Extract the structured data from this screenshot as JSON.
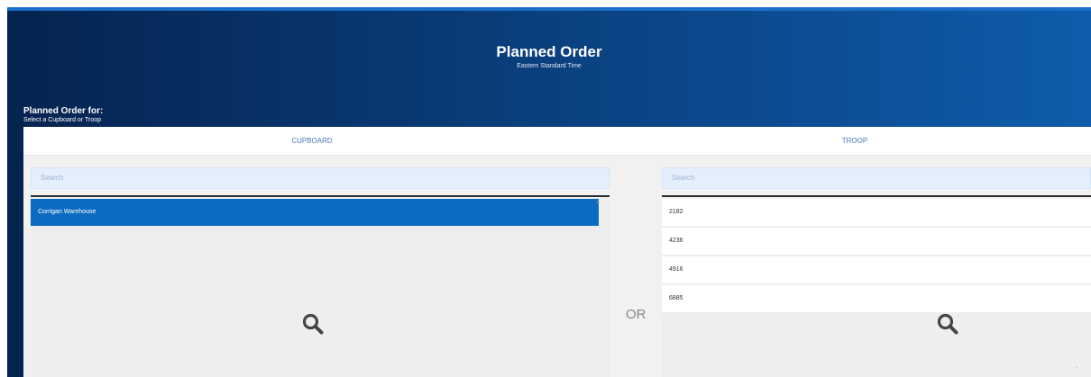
{
  "header": {
    "title": "Planned Order",
    "subtitle": "Eastern Standard Time"
  },
  "planned_for": {
    "title": "Planned Order for:",
    "subtitle": "Select a Cupboard or Troop"
  },
  "tabs": [
    {
      "label": "CUPBOARD"
    },
    {
      "label": "TROOP"
    }
  ],
  "cupboard": {
    "search_placeholder": "Search",
    "items": [
      {
        "label": "Corrigan Warehouse",
        "selected": true
      }
    ],
    "empty_icon": "search-icon"
  },
  "separator": "OR",
  "troop": {
    "search_placeholder": "Search",
    "items": [
      {
        "label": "2182"
      },
      {
        "label": "4236"
      },
      {
        "label": "4916"
      },
      {
        "label": "6885"
      }
    ],
    "empty_icon": "search-icon"
  },
  "colors": {
    "header_dark": "#05234f",
    "header_light": "#0e5cab",
    "selected_item": "#0b6bc2",
    "search_bg": "#e4effc"
  }
}
